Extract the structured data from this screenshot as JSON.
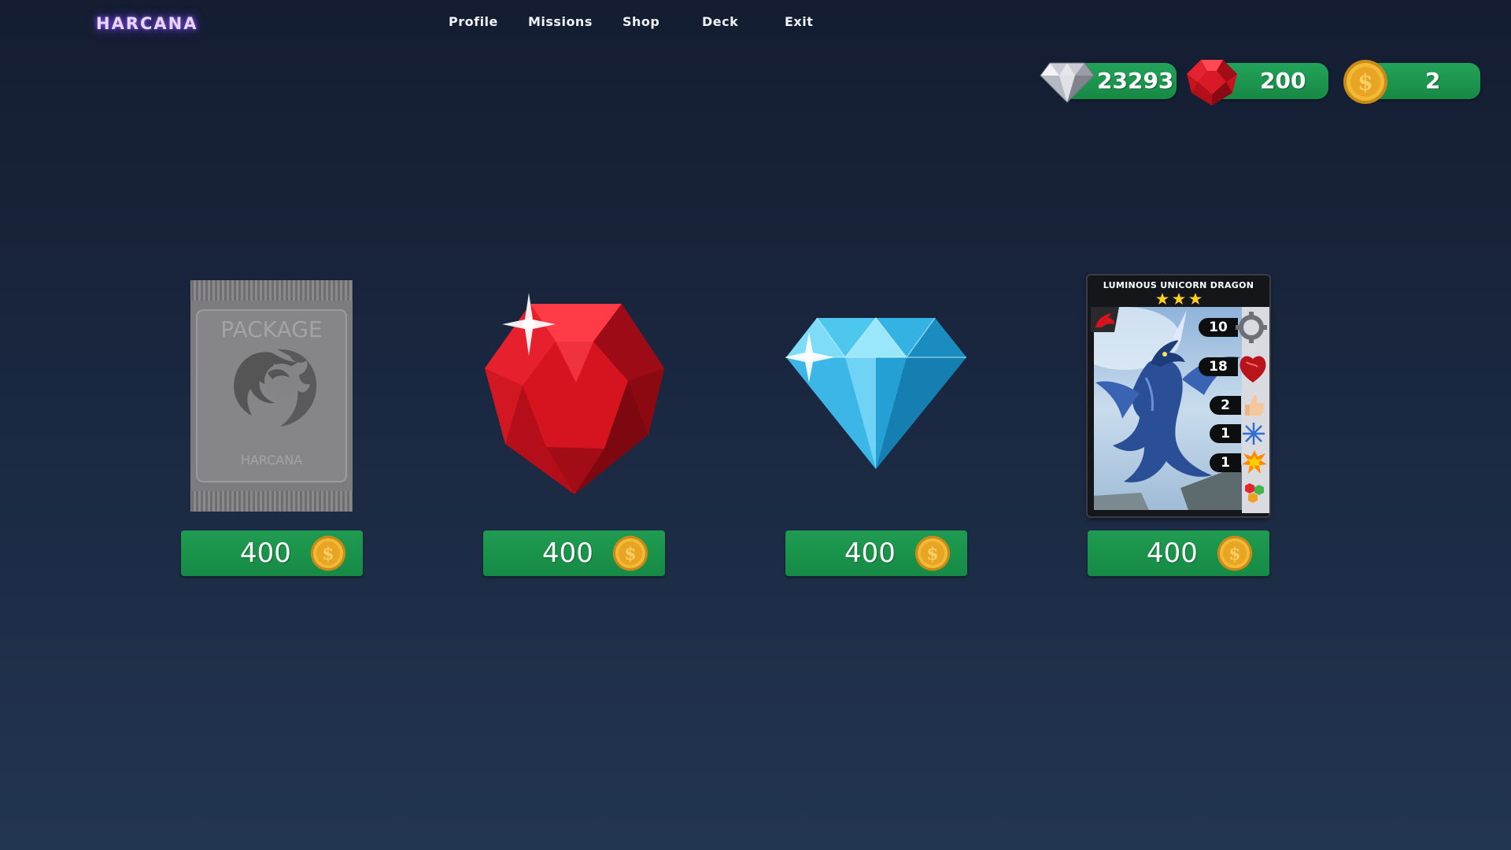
{
  "logo": "HARCANA",
  "nav": [
    {
      "label": "Profile"
    },
    {
      "label": "Missions"
    },
    {
      "label": "Shop"
    },
    {
      "label": "Deck"
    },
    {
      "label": "Exit"
    }
  ],
  "currencies": [
    {
      "name": "diamond",
      "icon": "diamond-icon",
      "value": "23293"
    },
    {
      "name": "ruby",
      "icon": "ruby-icon",
      "value": "200"
    },
    {
      "name": "coin",
      "icon": "coin-icon",
      "value": "2"
    }
  ],
  "shop_items": [
    {
      "name": "package",
      "package_text": "PACKAGE",
      "package_brand": "HARCANA",
      "price": "400",
      "price_icon": "coin-icon"
    },
    {
      "name": "ruby",
      "price": "400",
      "price_icon": "coin-icon"
    },
    {
      "name": "diamond",
      "price": "400",
      "price_icon": "coin-icon"
    },
    {
      "name": "card",
      "price": "400",
      "price_icon": "coin-icon",
      "card": {
        "title": "LUMINOUS UNICORN DRAGON",
        "stars": 3,
        "stats": [
          {
            "value": "10",
            "icon": "gear-icon"
          },
          {
            "value": "18",
            "icon": "heart-icon"
          },
          {
            "value": "2",
            "icon": "thumbs-up-icon"
          },
          {
            "value": "1",
            "icon": "snowflake-icon"
          },
          {
            "value": "1",
            "icon": "explosion-icon"
          }
        ]
      }
    }
  ],
  "colors": {
    "accent_green": "#1f9c51",
    "background_top": "#141d31",
    "background_bottom": "#22354f",
    "logo_glow": "#8a5cff"
  }
}
